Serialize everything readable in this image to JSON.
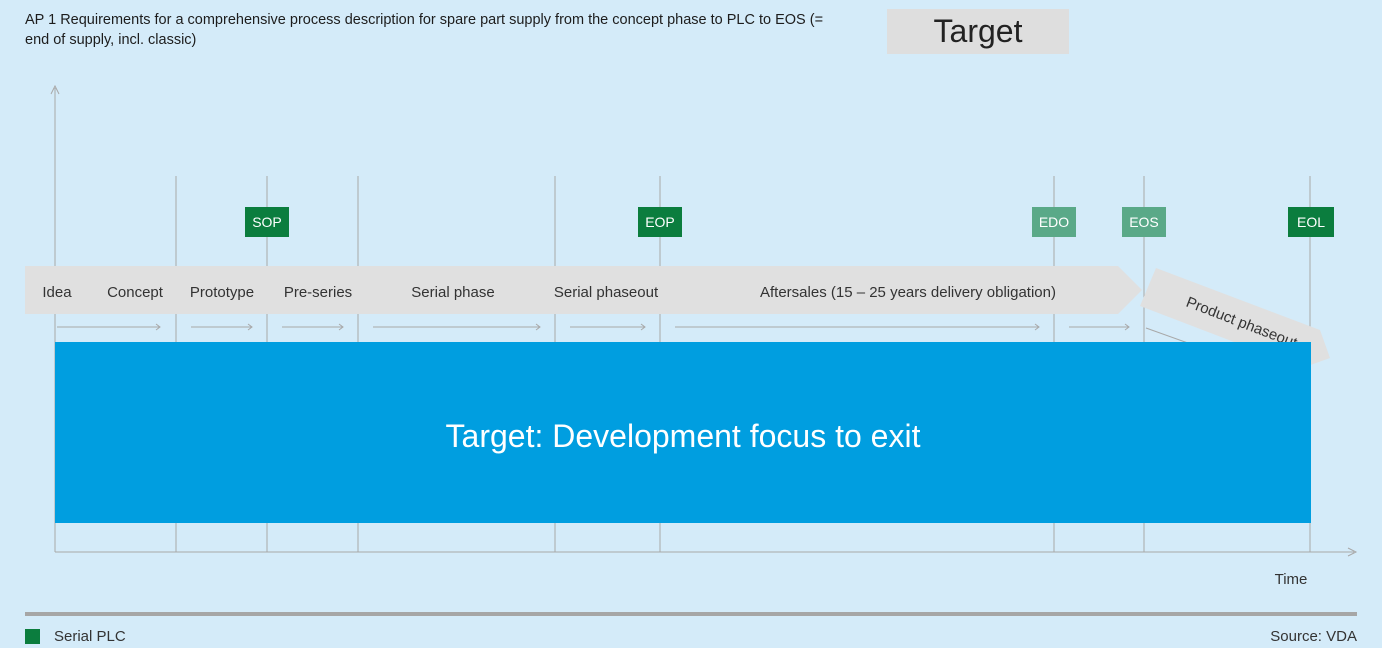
{
  "title": "AP 1 Requirements for a comprehensive process description for spare part supply from the concept phase to PLC to EOS (= end of supply, incl. classic)",
  "target_label": "Target",
  "phases": [
    "Idea",
    "Concept",
    "Prototype",
    "Pre-series",
    "Serial phase",
    "Serial phaseout",
    "Aftersales (15 – 25 years delivery obligation)"
  ],
  "phaseout_label": "Product phaseout",
  "milestones": [
    {
      "label": "SOP",
      "style": "dark"
    },
    {
      "label": "EOP",
      "style": "dark"
    },
    {
      "label": "EDO",
      "style": "light"
    },
    {
      "label": "EOS",
      "style": "light"
    },
    {
      "label": "EOL",
      "style": "dark"
    }
  ],
  "band_label": "Target: Development focus to exit",
  "axis_label_x": "Time",
  "legend_label": "Serial PLC",
  "source": "Source: VDA",
  "colors": {
    "background": "#d4ebf9",
    "band": "#009ee0",
    "milestone_dark": "#0b7d3e",
    "milestone_light": "#5aa988",
    "arrow": "#e0e0e0",
    "target_box": "#dedede"
  }
}
